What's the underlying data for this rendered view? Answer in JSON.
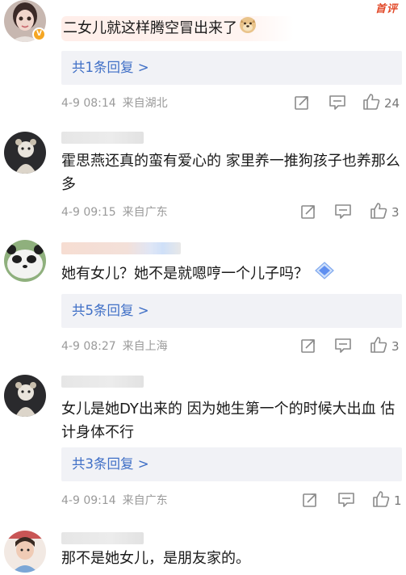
{
  "hot_tag": "首评",
  "comments": [
    {
      "text": "二女儿就这样腾空冒出来了",
      "reply_label": "共1条回复 >",
      "date": "4-9 08:14",
      "location": "来自湖北",
      "likes": "24",
      "emoji": "doge-emoji",
      "badge": "V"
    },
    {
      "text": "霍思燕还真的蛮有爱心的 家里养一推狗孩子也养那么多",
      "date": "4-9 09:15",
      "location": "来自广东",
      "likes": "3"
    },
    {
      "text": "她有女儿？她不是就嗯哼一个儿子吗？",
      "reply_label": "共5条回复 >",
      "date": "4-9 08:27",
      "location": "来自上海",
      "likes": "3"
    },
    {
      "text": "女儿是她DY出来的 因为她生第一个的时候大出血 估计身体不行",
      "reply_label": "共3条回复 >",
      "date": "4-9 09:14",
      "location": "来自广东",
      "likes": "1"
    },
    {
      "text": "那不是她女儿，是朋友家的。"
    }
  ],
  "icons": [
    "share-icon",
    "comment-icon",
    "like-icon"
  ],
  "colors": {
    "link": "#3f6fc6",
    "meta": "#9a9a9a",
    "reply_bg": "#f1f2f6",
    "hot": "#e24a2a"
  }
}
